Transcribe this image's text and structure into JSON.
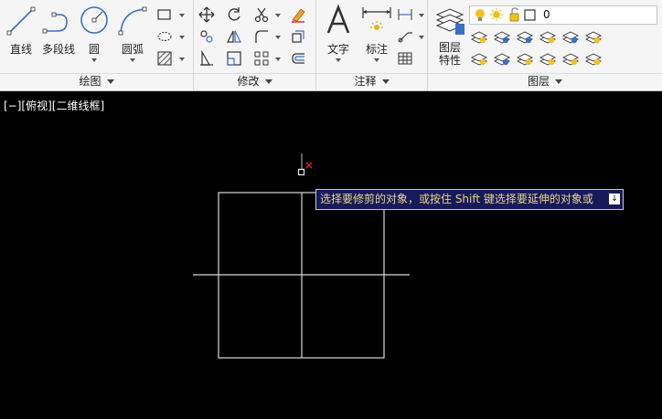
{
  "draw_panel": {
    "title": "绘图",
    "line_label": "直线",
    "polyline_label": "多段线",
    "circle_label": "圆",
    "arc_label": "圆弧"
  },
  "modify_panel": {
    "title": "修改"
  },
  "annotate_panel": {
    "title": "注释",
    "text_label": "文字",
    "dimension_label": "标注"
  },
  "layers_panel": {
    "title": "图层",
    "layer_props_label_1": "图层",
    "layer_props_label_2": "特性",
    "current_layer": "0"
  },
  "viewport": {
    "label": "[−][俯视][二维线框]"
  },
  "tooltip": {
    "text": "选择要修剪的对象，或按住 Shift 键选择要延伸的对象或"
  },
  "colors": {
    "ribbon_bg": "#f5f5f5",
    "canvas_bg": "#000000",
    "geometry": "#d8d8d8",
    "tooltip_bg": "#171a5a",
    "tooltip_text": "#e8d48a",
    "cursor_x": "#e02020"
  }
}
